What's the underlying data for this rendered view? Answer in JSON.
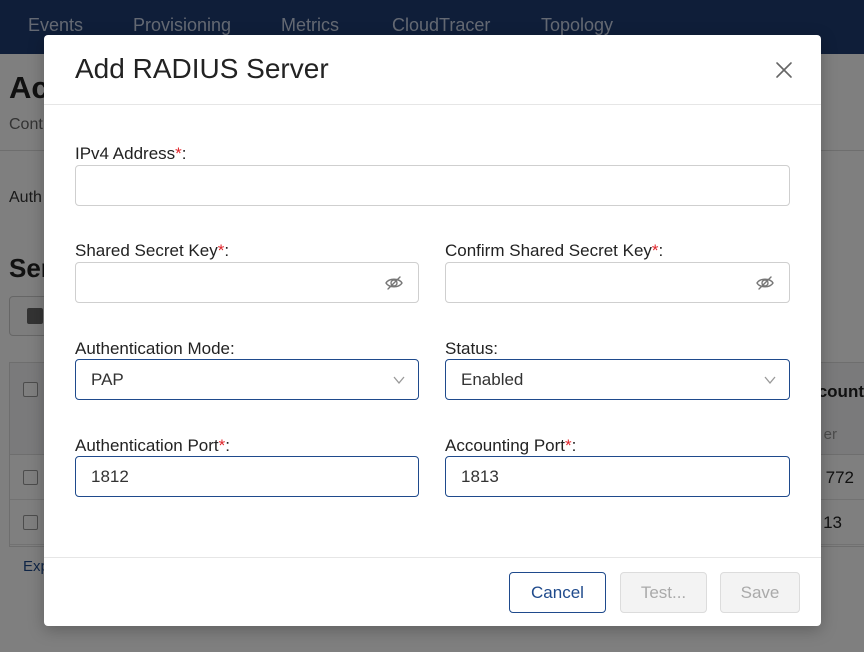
{
  "nav": {
    "items": [
      "Events",
      "Provisioning",
      "Metrics",
      "CloudTracer",
      "Topology"
    ]
  },
  "background": {
    "title_partial": "Ac",
    "subtitle_partial": "Cont",
    "auth_partial": "Auth",
    "section_partial": "Ser",
    "table_header_partial": "ccount",
    "table_subheader_partial": "er",
    "rows": [
      "772",
      "13"
    ],
    "export_partial": "Exp"
  },
  "modal": {
    "title": "Add RADIUS Server",
    "fields": {
      "ipv4": {
        "label": "IPv4 Address",
        "required": "*",
        "suffix": ":",
        "value": ""
      },
      "shared_secret": {
        "label": "Shared Secret Key",
        "required": "*",
        "suffix": ":",
        "value": ""
      },
      "confirm_secret": {
        "label": "Confirm Shared Secret Key",
        "required": "*",
        "suffix": ":",
        "value": ""
      },
      "auth_mode": {
        "label": "Authentication Mode",
        "suffix": ":",
        "value": "PAP"
      },
      "status": {
        "label": "Status",
        "suffix": ":",
        "value": "Enabled"
      },
      "auth_port": {
        "label": "Authentication Port",
        "required": "*",
        "suffix": ":",
        "value": "1812"
      },
      "acct_port": {
        "label": "Accounting Port",
        "required": "*",
        "suffix": ":",
        "value": "1813"
      }
    },
    "buttons": {
      "cancel": "Cancel",
      "test": "Test...",
      "save": "Save"
    }
  },
  "colors": {
    "nav_bg": "#1e3c73",
    "accent": "#1f4a8c",
    "required": "#e0242a",
    "disabled_text": "#aaaaaa"
  },
  "icons": {
    "close": "close-icon",
    "password_toggle": "eye-slash-icon",
    "dropdown": "chevron-down-icon",
    "delete": "trash-icon"
  }
}
